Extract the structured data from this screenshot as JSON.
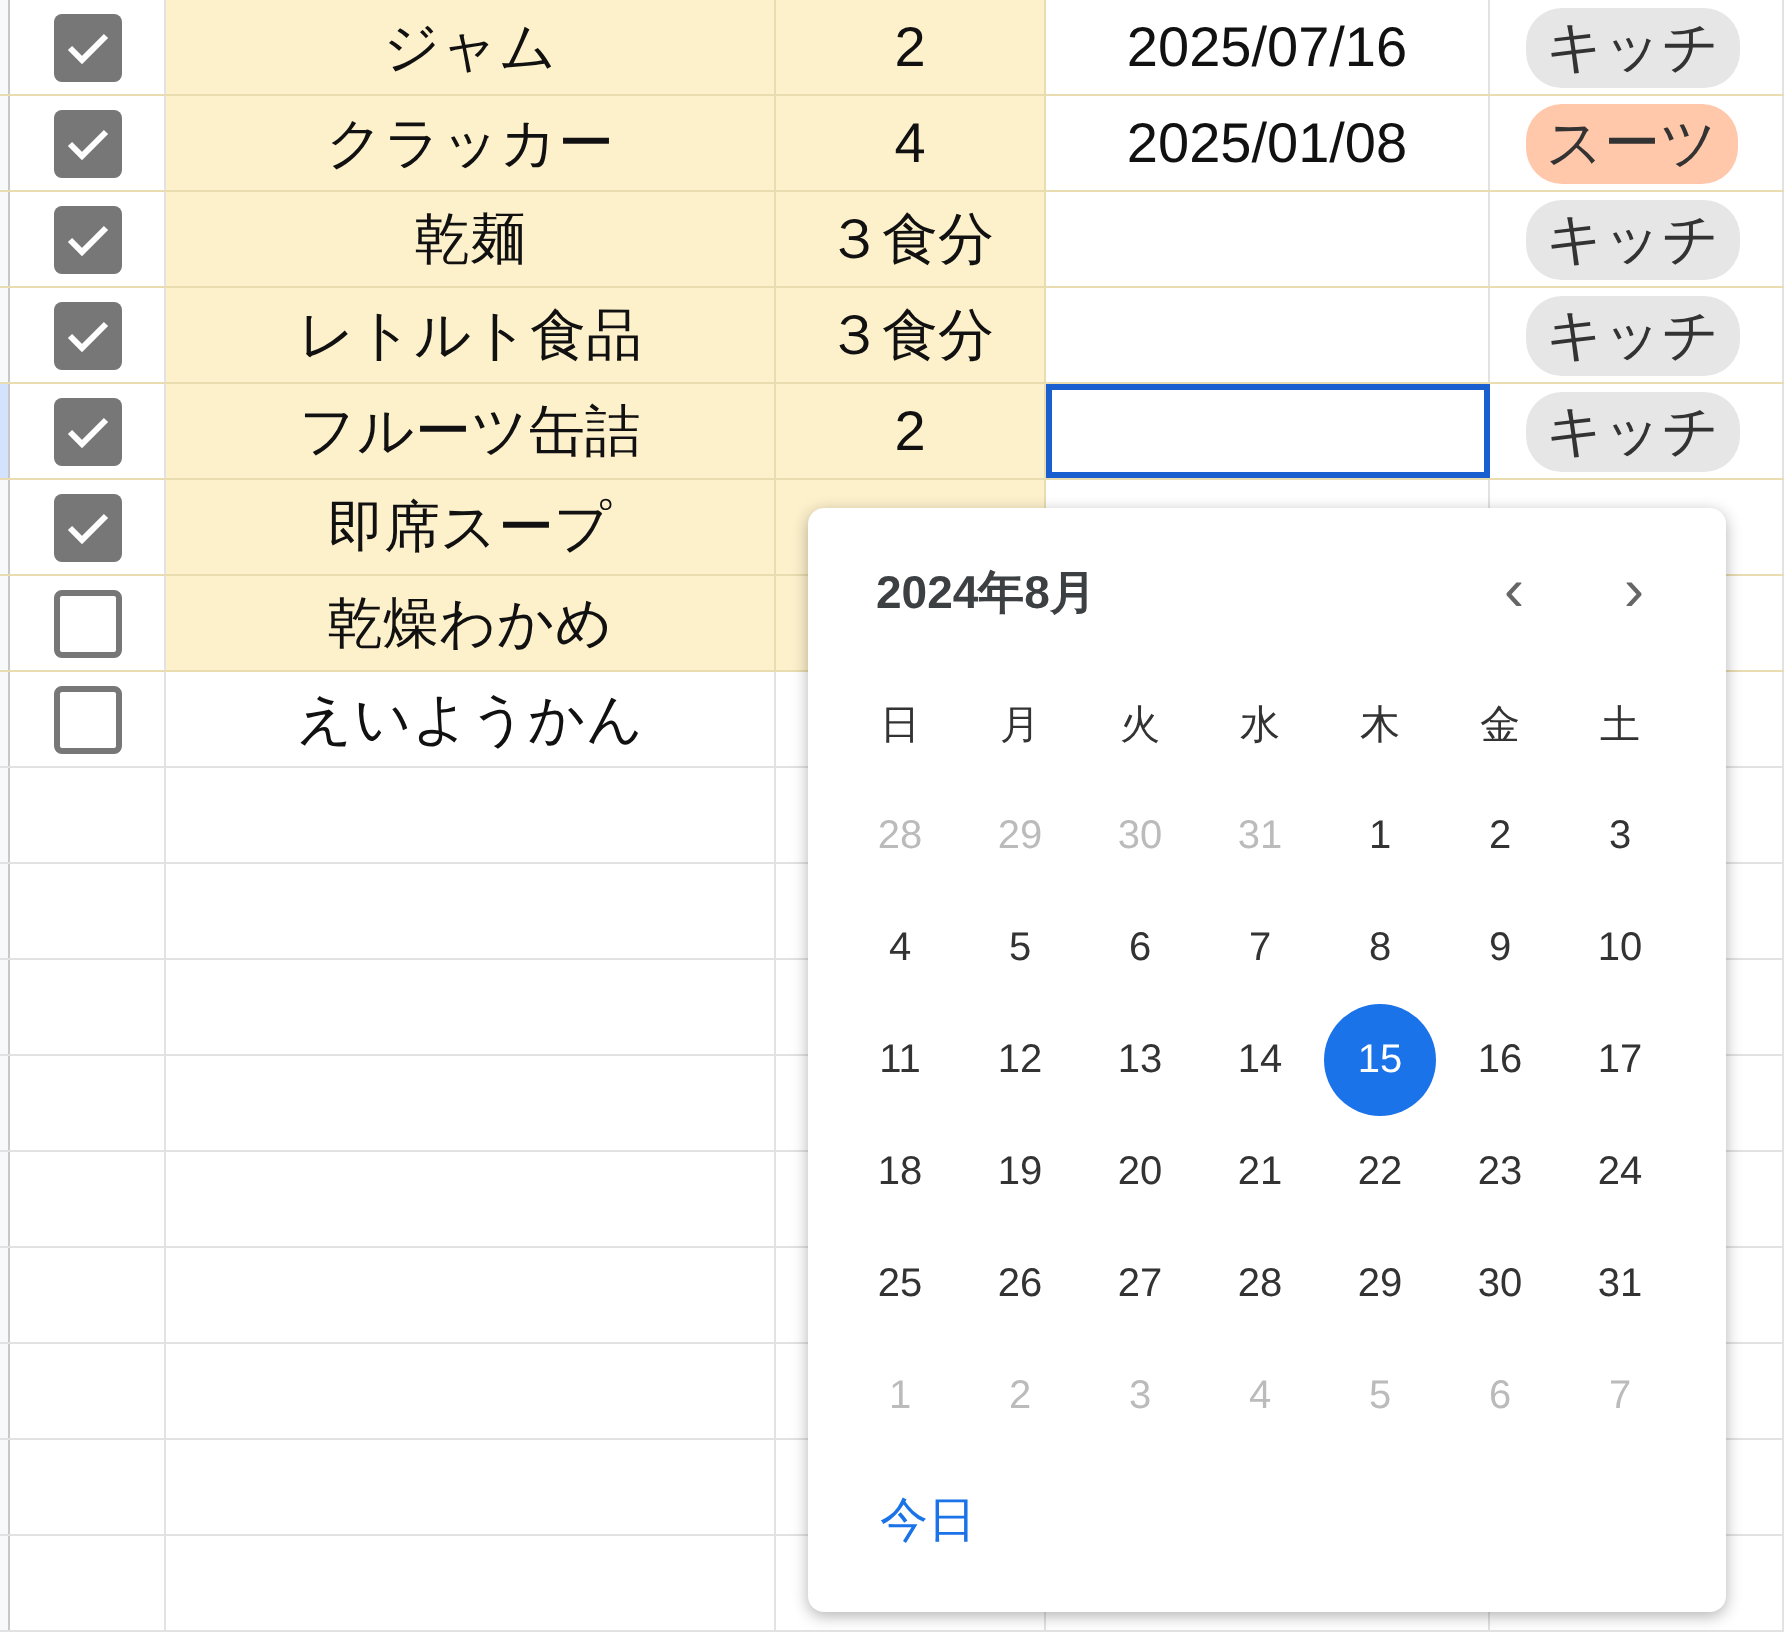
{
  "rows": [
    {
      "checked": true,
      "name": "ジャム",
      "quantity": "2",
      "date": "2025/07/16",
      "highlighted": true,
      "selected": false,
      "location": {
        "label": "キッチ",
        "color": "#e6e6e6"
      }
    },
    {
      "checked": true,
      "name": "クラッカー",
      "quantity": "4",
      "date": "2025/01/08",
      "highlighted": true,
      "selected": false,
      "location": {
        "label": "スーツ",
        "color": "#ffc8aa"
      }
    },
    {
      "checked": true,
      "name": "乾麺",
      "quantity": "３食分",
      "highlighted": true,
      "selected": false,
      "location": {
        "label": "キッチ",
        "color": "#e6e6e6"
      }
    },
    {
      "checked": true,
      "name": "レトルト食品",
      "quantity": "３食分",
      "highlighted": true,
      "selected": false,
      "location": {
        "label": "キッチ",
        "color": "#e6e6e6"
      }
    },
    {
      "checked": true,
      "name": "フルーツ缶詰",
      "quantity": "2",
      "highlighted": true,
      "selected": true,
      "location": {
        "label": "キッチ",
        "color": "#e6e6e6"
      }
    },
    {
      "checked": true,
      "name": "即席スープ",
      "highlighted": true,
      "selected": false
    },
    {
      "checked": false,
      "name": "乾燥わかめ",
      "highlighted": true,
      "selected": false
    },
    {
      "checked": false,
      "name": "えいようかん",
      "highlighted": false,
      "selected": false
    }
  ],
  "date_picker": {
    "month_title": "2024年8月",
    "prev": "‹",
    "next": "›",
    "weekdays": [
      "日",
      "月",
      "火",
      "水",
      "木",
      "金",
      "土"
    ],
    "days": [
      {
        "label": "28",
        "outside": true,
        "selected": false
      },
      {
        "label": "29",
        "outside": true,
        "selected": false
      },
      {
        "label": "30",
        "outside": true,
        "selected": false
      },
      {
        "label": "31",
        "outside": true,
        "selected": false
      },
      {
        "label": "1",
        "outside": false,
        "selected": false
      },
      {
        "label": "2",
        "outside": false,
        "selected": false
      },
      {
        "label": "3",
        "outside": false,
        "selected": false
      },
      {
        "label": "4",
        "outside": false,
        "selected": false
      },
      {
        "label": "5",
        "outside": false,
        "selected": false
      },
      {
        "label": "6",
        "outside": false,
        "selected": false
      },
      {
        "label": "7",
        "outside": false,
        "selected": false
      },
      {
        "label": "8",
        "outside": false,
        "selected": false
      },
      {
        "label": "9",
        "outside": false,
        "selected": false
      },
      {
        "label": "10",
        "outside": false,
        "selected": false
      },
      {
        "label": "11",
        "outside": false,
        "selected": false
      },
      {
        "label": "12",
        "outside": false,
        "selected": false
      },
      {
        "label": "13",
        "outside": false,
        "selected": false
      },
      {
        "label": "14",
        "outside": false,
        "selected": false
      },
      {
        "label": "15",
        "outside": false,
        "selected": true
      },
      {
        "label": "16",
        "outside": false,
        "selected": false
      },
      {
        "label": "17",
        "outside": false,
        "selected": false
      },
      {
        "label": "18",
        "outside": false,
        "selected": false
      },
      {
        "label": "19",
        "outside": false,
        "selected": false
      },
      {
        "label": "20",
        "outside": false,
        "selected": false
      },
      {
        "label": "21",
        "outside": false,
        "selected": false
      },
      {
        "label": "22",
        "outside": false,
        "selected": false
      },
      {
        "label": "23",
        "outside": false,
        "selected": false
      },
      {
        "label": "24",
        "outside": false,
        "selected": false
      },
      {
        "label": "25",
        "outside": false,
        "selected": false
      },
      {
        "label": "26",
        "outside": false,
        "selected": false
      },
      {
        "label": "27",
        "outside": false,
        "selected": false
      },
      {
        "label": "28",
        "outside": false,
        "selected": false
      },
      {
        "label": "29",
        "outside": false,
        "selected": false
      },
      {
        "label": "30",
        "outside": false,
        "selected": false
      },
      {
        "label": "31",
        "outside": false,
        "selected": false
      },
      {
        "label": "1",
        "outside": true,
        "selected": false
      },
      {
        "label": "2",
        "outside": true,
        "selected": false
      },
      {
        "label": "3",
        "outside": true,
        "selected": false
      },
      {
        "label": "4",
        "outside": true,
        "selected": false
      },
      {
        "label": "5",
        "outside": true,
        "selected": false
      },
      {
        "label": "6",
        "outside": true,
        "selected": false
      },
      {
        "label": "7",
        "outside": true,
        "selected": false
      }
    ],
    "today_button": "今日"
  }
}
